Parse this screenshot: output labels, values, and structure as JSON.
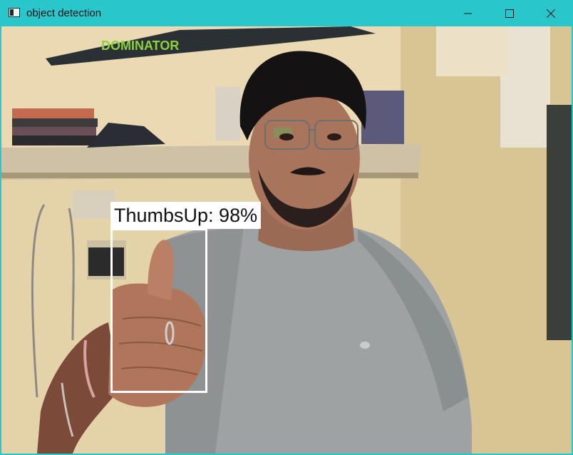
{
  "window": {
    "title": "object detection",
    "icon": "window-app-icon",
    "controls": {
      "minimize_icon": "minimize-icon",
      "maximize_icon": "maximize-icon",
      "close_icon": "close-icon"
    },
    "accent_color": "#29c6cc"
  },
  "detection": {
    "label": "ThumbsUp: 98%",
    "box_color": "#ffffff"
  },
  "scene": {
    "board_text": "DOMINATOR"
  }
}
